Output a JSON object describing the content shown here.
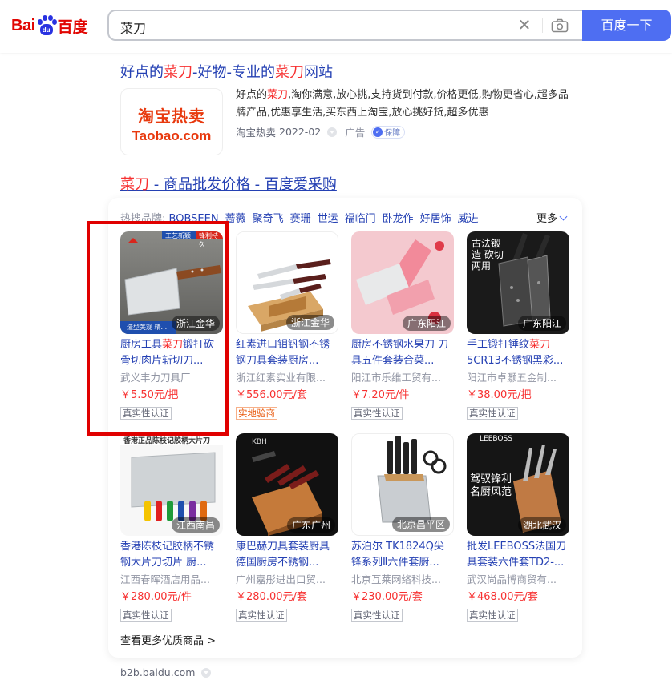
{
  "header": {
    "logo_text_latin": "Bai",
    "logo_paw_text": "du",
    "logo_text_cn": "百度",
    "query": "菜刀",
    "search_button": "百度一下"
  },
  "ad": {
    "title": [
      "好点的",
      "菜刀",
      "-好物-专业的",
      "菜刀",
      "网站"
    ],
    "thumb_line1": "淘宝热卖",
    "thumb_line2": "Taobao.com",
    "desc": [
      "好点的",
      "菜刀",
      ",淘你满意,放心挑,支持货到付款,价格更低,购物更省心,超多品牌产品,优惠享生活,买东西上淘宝,放心挑好货,超多优惠"
    ],
    "source": "淘宝热卖",
    "date": "2022-02",
    "ad_label": "广告",
    "guard_label": "保障"
  },
  "b2b": {
    "title": [
      "菜刀",
      " - 商品批发价格 - 百度爱采购"
    ],
    "brands_label": "热搜品牌:",
    "brands": [
      "BOBSEEN",
      "蔷薇",
      "聚奇飞",
      "赛珊",
      "世运",
      "福临门",
      "卧龙作",
      "好居饰",
      "威进"
    ],
    "more_label": "更多",
    "products": [
      {
        "loc": "浙江金华",
        "name_pre": "厨房工具",
        "name_em": "菜刀",
        "name_post": "锻打砍骨切肉片斩切刀...",
        "seller": "武义丰力刀具厂",
        "price": "￥5.50元/把",
        "badge": "真实性认证",
        "badge_style": "gray"
      },
      {
        "loc": "浙江金华",
        "name_pre": "红素进口钼钒钢不锈钢刀具套装厨房...",
        "name_em": "",
        "name_post": "",
        "seller": "浙江红素实业有限...",
        "price": "￥556.00元/套",
        "badge": "实地验商",
        "badge_style": "orange"
      },
      {
        "loc": "广东阳江",
        "name_pre": "厨房不锈钢水果刀 刀具五件套装合菜...",
        "name_em": "",
        "name_post": "",
        "seller": "阳江市乐维工贸有...",
        "price": "￥7.20元/件",
        "badge": "真实性认证",
        "badge_style": "gray"
      },
      {
        "loc": "广东阳江",
        "name_pre": "手工锻打锤纹",
        "name_em": "菜刀",
        "name_post": " 5CR13不锈钢黑彩...",
        "seller": "阳江市卓灏五金制...",
        "price": "￥38.00元/把",
        "badge": "真实性认证",
        "badge_style": "gray"
      },
      {
        "loc": "江西南昌",
        "name_pre": "香港陈枝记胶柄不锈钢大片刀切片 厨...",
        "name_em": "",
        "name_post": "",
        "seller": "江西春晖酒店用品...",
        "price": "￥280.00元/件",
        "badge": "真实性认证",
        "badge_style": "gray"
      },
      {
        "loc": "广东广州",
        "name_pre": "康巴赫刀具套装厨具德国厨房不锈钢...",
        "name_em": "",
        "name_post": "",
        "seller": "广州嘉彤进出口贸...",
        "price": "￥280.00元/套",
        "badge": "真实性认证",
        "badge_style": "gray"
      },
      {
        "loc": "北京昌平区",
        "name_pre": "苏泊尔 TK1824Q尖锋系列Ⅱ六件套厨...",
        "name_em": "",
        "name_post": "",
        "seller": "北京互莱网络科技...",
        "price": "￥230.00元/套",
        "badge": "真实性认证",
        "badge_style": "gray"
      },
      {
        "loc": "湖北武汉",
        "name_pre": "批发LEEBOSS法国刀具套装六件套TD2-...",
        "name_em": "",
        "name_post": "",
        "seller": "武汉尚品博商贸有...",
        "price": "￥468.00元/套",
        "badge": "真实性认证",
        "badge_style": "gray"
      }
    ],
    "see_more": "查看更多优质商品 >",
    "source": "b2b.baidu.com",
    "img_text": {
      "p0_tag1": "工艺新颖",
      "p0_tag2": "锋利持久",
      "p0_bottom": "造型美观 精...",
      "p3_text": "古法锻造 砍切两用",
      "p4_banner": "香港正品陈枝记胶柄大片刀",
      "p5_brand": "KBH",
      "p7_brand": "LEEBOSS",
      "p7_text": "驾驭锋利 名厨风范"
    }
  },
  "colors": {
    "accent": "#4e6ef2",
    "link": "#2440b3",
    "highlight": "#f73131",
    "annotation": "#e00000"
  }
}
